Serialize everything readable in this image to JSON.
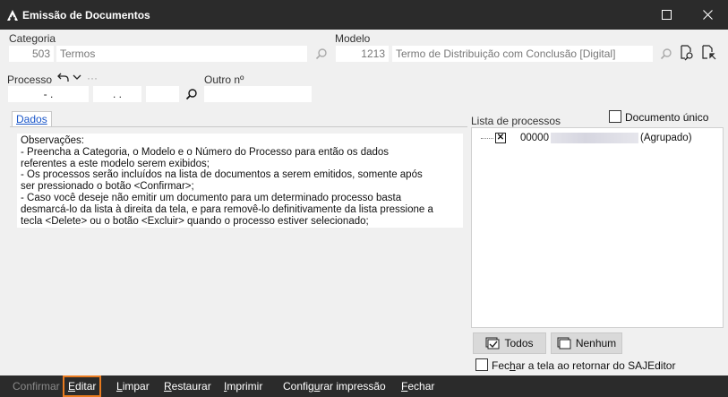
{
  "window": {
    "title": "Emissão de Documentos",
    "colors": {
      "titlebar": "#2b2b2b",
      "footer": "#2b2b2b",
      "focus_outline": "#e87a1f",
      "tab_link": "#1a56c9"
    }
  },
  "form": {
    "categoria": {
      "label": "Categoria",
      "code": "503",
      "name": "Termos"
    },
    "modelo": {
      "label": "Modelo",
      "code": "1213",
      "name": "Termo de Distribuição com Conclusão [Digital]"
    },
    "processo": {
      "label": "Processo",
      "part1": "- .",
      "part2": ". .",
      "part3": "",
      "more": "···"
    },
    "outro": {
      "label": "Outro nº",
      "value": ""
    }
  },
  "tabs": [
    {
      "label": "Dados",
      "active": true
    }
  ],
  "observacoes": {
    "lines": [
      "Observações:",
      "  - Preencha a Categoria, o Modelo e o Número do Processo para então os dados",
      "referentes a este modelo serem exibidos;",
      "  - Os processos serão incluídos na lista de documentos a serem emitidos, somente após",
      "ser pressionado o botão <Confirmar>;",
      "  - Caso você deseje não emitir um documento para um determinado processo basta",
      "desmarcá-lo da lista à direita da tela, e para removê-lo definitivamente da lista pressione a",
      "tecla <Delete> ou o botão <Excluir> quando o processo estiver selecionado;"
    ]
  },
  "lista": {
    "label": "Lista de processos",
    "documento_unico": {
      "label": "Documento único",
      "checked": false
    },
    "items": [
      {
        "prefix": "00000",
        "suffix": "(Agrupado)",
        "checked": true
      }
    ],
    "todos_label": "Todos",
    "nenhum_label": "Nenhum",
    "fechar_tela": {
      "label_pre": "Fec",
      "label_u": "h",
      "label_post": "ar a tela ao retornar do SAJEditor",
      "checked": false
    }
  },
  "footer": {
    "confirmar": "Confirmar",
    "editar_u": "E",
    "editar": "ditar",
    "limpar_u": "L",
    "limpar": "impar",
    "restaurar_u": "R",
    "restaurar": "estaurar",
    "imprimir_u": "I",
    "imprimir": "mprimir",
    "configurar_pre": "Config",
    "configurar_u": "u",
    "configurar_post": "rar impressão",
    "fechar_u": "F",
    "fechar": "echar"
  }
}
